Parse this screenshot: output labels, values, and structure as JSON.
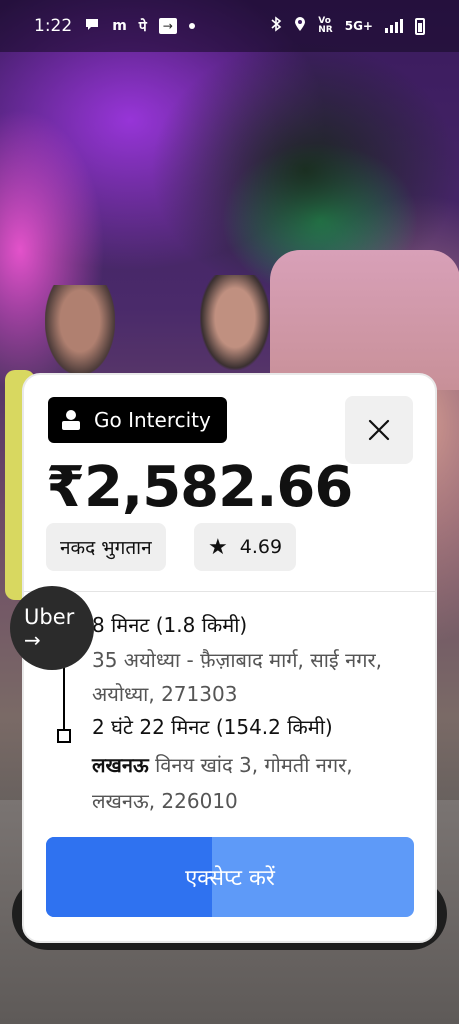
{
  "status_bar": {
    "time": "1:22",
    "icons": [
      "chat-bubble-icon",
      "m-app-icon",
      "pe-app-icon",
      "forward-box-icon",
      "dot-icon"
    ],
    "m_glyph": "m",
    "pe_glyph": "पे",
    "network_small": "Vo\nNR",
    "network": "5G+"
  },
  "card": {
    "badge_label": "Go Intercity",
    "price": "₹2,582.66",
    "payment_chip": "नकद भुगतान",
    "rating": "4.69",
    "pickup_time": "8 मिनट (1.8 किमी)",
    "pickup_address": "35 अयोध्या - फ़ैज़ाबाद मार्ग, साई नगर, अयोध्या, 271303",
    "dropoff_time": "2 घंटे 22 मिनट (154.2 किमी)",
    "dropoff_city": "लखनऊ",
    "dropoff_address": "विनय खांद 3, गोमती नगर, लखनऊ, 226010",
    "accept_label": "एक्सेप्ट करें",
    "accept_progress": 0.45
  },
  "uber_bubble": {
    "label": "Uber",
    "arrow": "→"
  }
}
